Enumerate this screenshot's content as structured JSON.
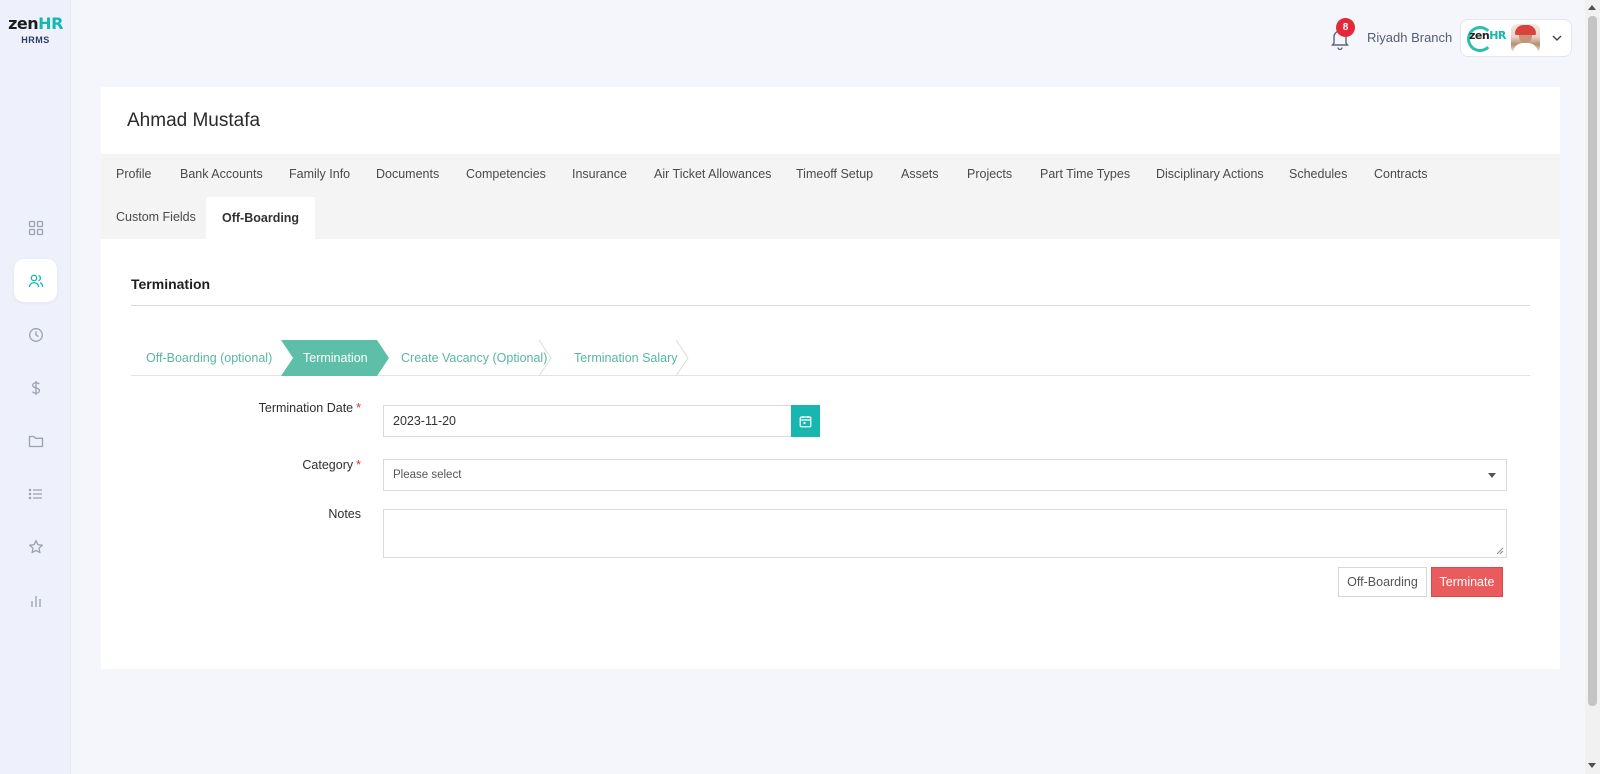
{
  "app": {
    "logo_main": "zen",
    "logo_accent": "HR",
    "logo_sub": "HRMS"
  },
  "sidebar": {
    "items": [
      {
        "icon": "dashboard-grid-icon"
      },
      {
        "icon": "users-icon",
        "active": true
      },
      {
        "icon": "clock-icon"
      },
      {
        "icon": "dollar-icon"
      },
      {
        "icon": "folder-icon"
      },
      {
        "icon": "list-icon"
      },
      {
        "icon": "star-icon"
      },
      {
        "icon": "bar-chart-icon"
      }
    ]
  },
  "topbar": {
    "notification_count": "8",
    "branch": "Riyadh Branch",
    "company_logo_main": "zen",
    "company_logo_accent": "HR"
  },
  "employee": {
    "name": "Ahmad Mustafa"
  },
  "tabs": [
    "Profile",
    "Bank Accounts",
    "Family Info",
    "Documents",
    "Competencies",
    "Insurance",
    "Air Ticket Allowances",
    "Timeoff Setup",
    "Assets",
    "Projects",
    "Part Time Types",
    "Disciplinary Actions",
    "Schedules",
    "Contracts",
    "Custom Fields",
    "Off-Boarding"
  ],
  "active_tab": "Off-Boarding",
  "section": {
    "title": "Termination"
  },
  "steps": [
    {
      "label": "Off-Boarding (optional)"
    },
    {
      "label": "Termination",
      "active": true
    },
    {
      "label": "Create Vacancy (Optional)"
    },
    {
      "label": "Termination Salary"
    }
  ],
  "form": {
    "termination_date": {
      "label": "Termination Date",
      "required_mark": "*",
      "value": "2023-11-20"
    },
    "category": {
      "label": "Category",
      "required_mark": "*",
      "placeholder": "Please select"
    },
    "notes": {
      "label": "Notes",
      "value": ""
    }
  },
  "buttons": {
    "off_boarding": "Off-Boarding",
    "terminate": "Terminate"
  },
  "colors": {
    "accent": "#17b7b0",
    "step_active": "#5ebfa8",
    "danger": "#ea5b5e",
    "badge": "#e02a3c"
  }
}
